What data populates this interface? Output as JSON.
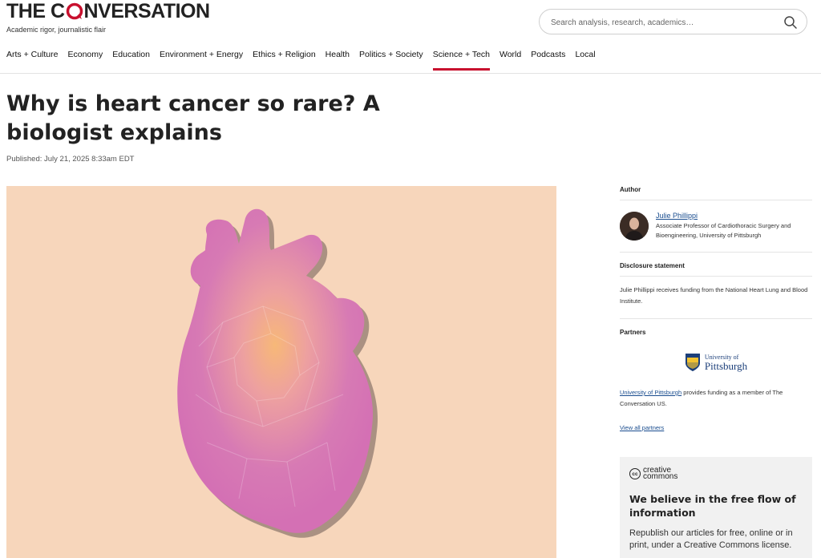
{
  "header": {
    "logo_pre": "THE C",
    "logo_post": "NVERSATION",
    "tagline": "Academic rigor, journalistic flair",
    "search_placeholder": "Search analysis, research, academics…"
  },
  "nav": {
    "items": [
      "Arts + Culture",
      "Economy",
      "Education",
      "Environment + Energy",
      "Ethics + Religion",
      "Health",
      "Politics + Society",
      "Science + Tech",
      "World",
      "Podcasts",
      "Local"
    ],
    "active": "Science + Tech"
  },
  "article": {
    "title": "Why is heart cancer so rare? A biologist explains",
    "published": "Published: July 21, 2025 8:33am EDT"
  },
  "sidebar": {
    "author_label": "Author",
    "author_name": "Julie Phillippi",
    "author_role": "Associate Professor of Cardiothoracic Surgery and Bioengineering, University of Pittsburgh",
    "disclosure_label": "Disclosure statement",
    "disclosure_text": "Julie Phillippi receives funding from the National Heart Lung and Blood Institute.",
    "partners_label": "Partners",
    "partner_logo_line1": "University of",
    "partner_logo_line2": "Pittsburgh",
    "partner_link": "University of Pittsburgh",
    "partner_text": " provides funding as a member of The Conversation US.",
    "view_all": "View all partners"
  },
  "cc": {
    "badge": "cc",
    "word1": "creative",
    "word2": "commons",
    "title": "We believe in the free flow of information",
    "body": "Republish our articles for free, online or in print, under a Creative Commons license."
  },
  "colors": {
    "accent": "#c8102e",
    "link": "#1a4d8f",
    "hero_bg": "#f7d6bb",
    "heart": "#d77ab4"
  }
}
